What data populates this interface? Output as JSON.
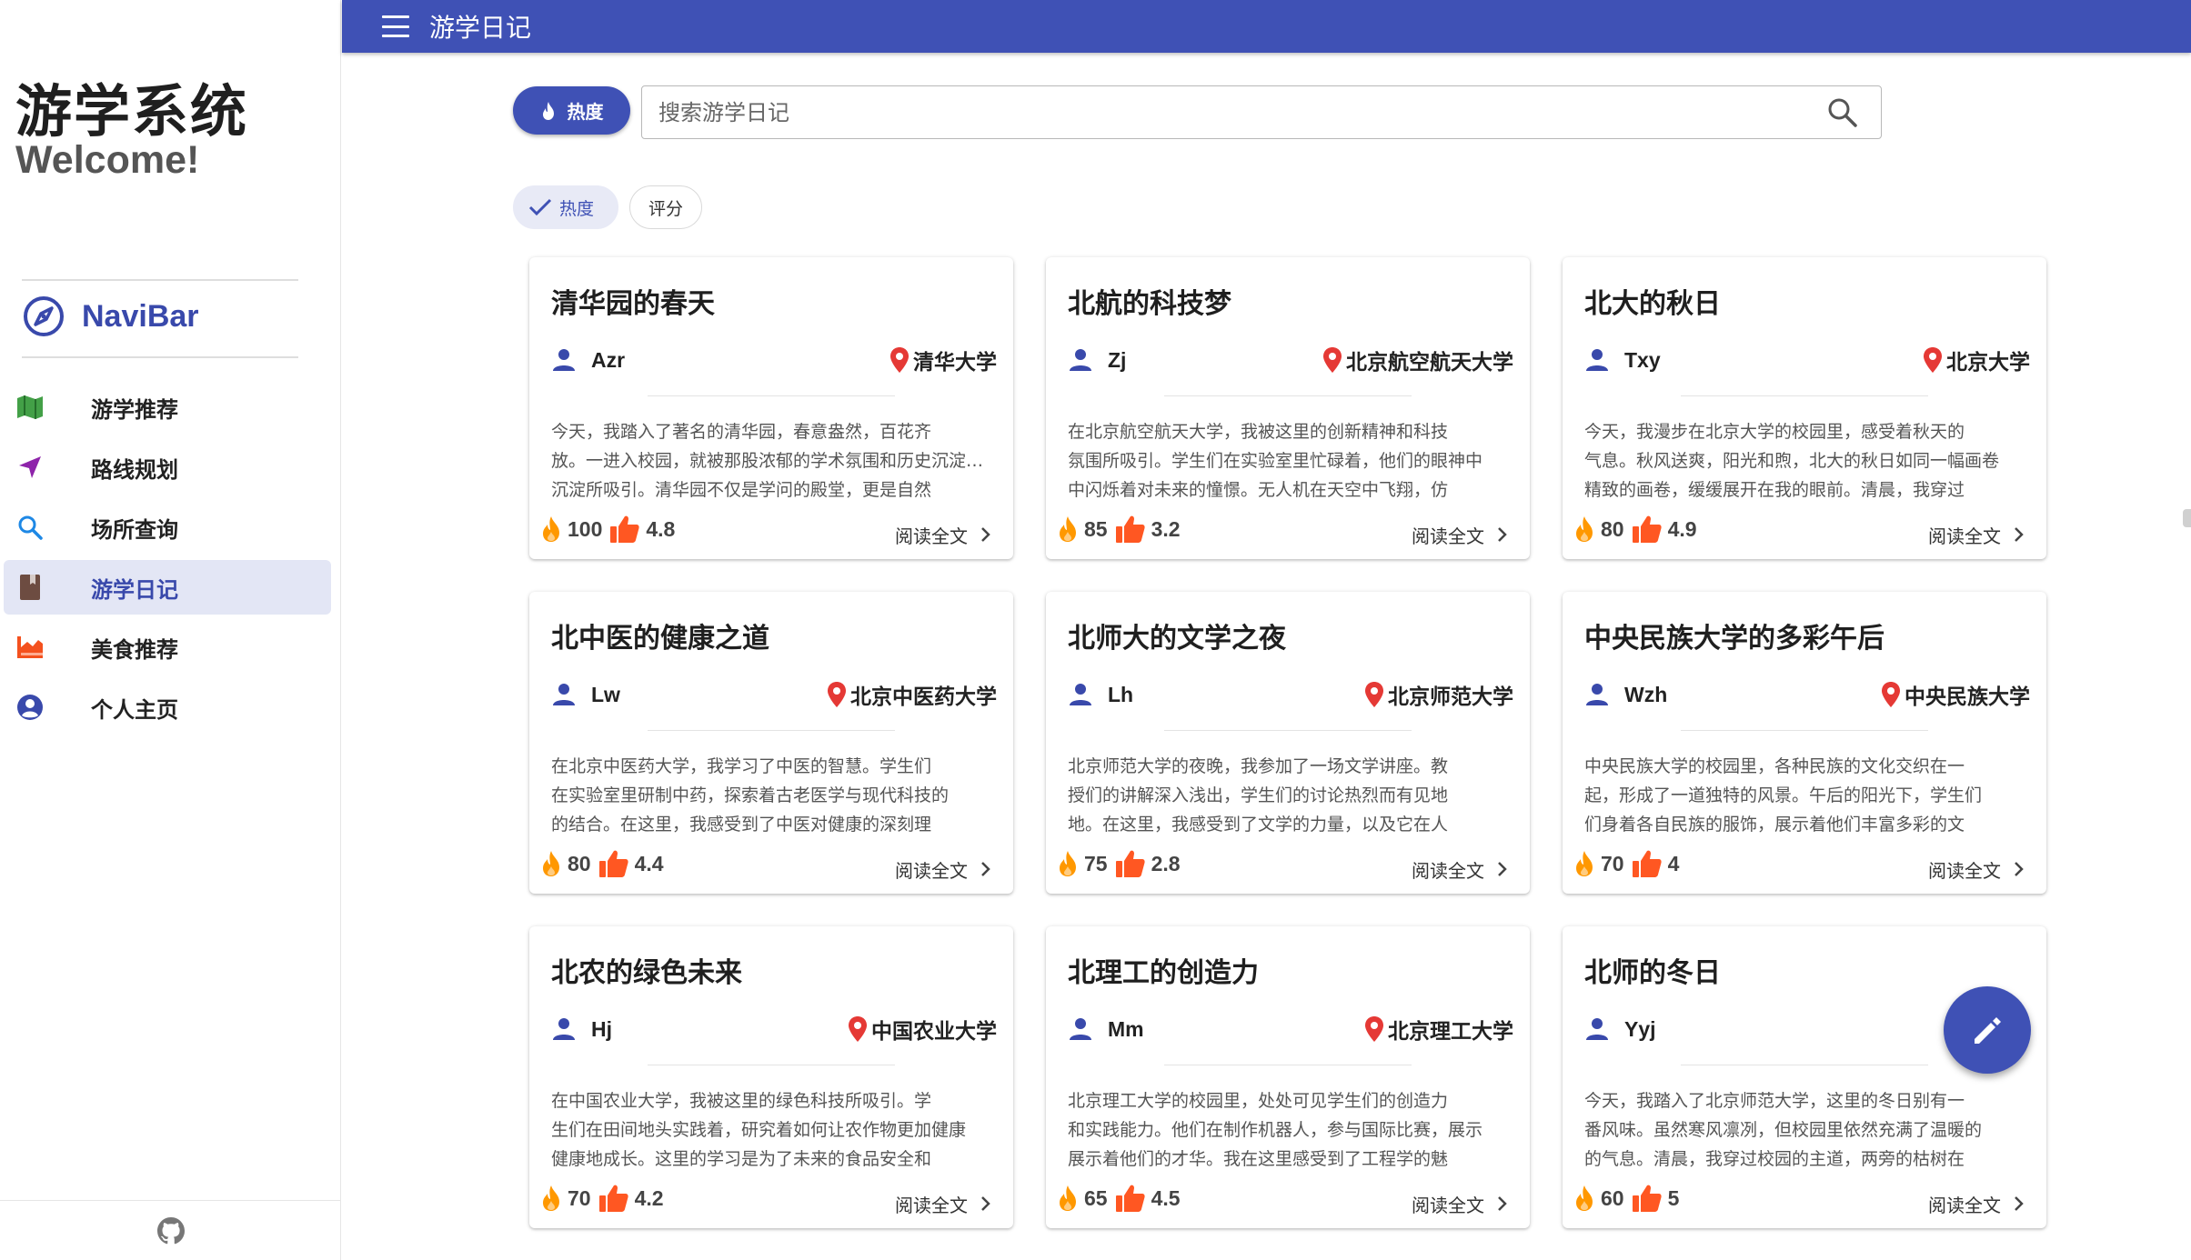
{
  "sidebar": {
    "title": "游学系统",
    "subtitle": "Welcome!",
    "navibar_label": "NaviBar",
    "items": [
      {
        "label": "游学推荐",
        "icon": "map-icon",
        "color": "#43a047"
      },
      {
        "label": "路线规划",
        "icon": "send-icon",
        "color": "#8e24aa"
      },
      {
        "label": "场所查询",
        "icon": "search-icon",
        "color": "#1e88e5"
      },
      {
        "label": "游学日记",
        "icon": "book-icon",
        "color": "#6d4c41",
        "active": true
      },
      {
        "label": "美食推荐",
        "icon": "food-icon",
        "color": "#f4511e"
      },
      {
        "label": "个人主页",
        "icon": "account-circle-icon",
        "color": "#3949ab"
      }
    ],
    "footer_icon": "github-icon"
  },
  "header": {
    "menu_icon": "menu-icon",
    "title": "游学日记",
    "bar_color": "#3f51b5"
  },
  "search": {
    "sort_button": "热度",
    "placeholder": "搜索游学日记",
    "icon": "search-icon"
  },
  "filters": {
    "hot": "热度",
    "hot_selected": true,
    "score": "评分"
  },
  "cards": [
    {
      "title": "清华园的春天",
      "author": "Azr",
      "place": "清华大学",
      "lines": [
        "今天，我踏入了著名的清华园，春意盎然，百花齐",
        "放。一进入校园，就被那股浓郁的学术氛围和历史沉淀所吸引。",
        "沉淀所吸引。清华园不仅是学问的殿堂，更是自然"
      ],
      "heat": "100",
      "rating": "4.8",
      "read_more": "阅读全文"
    },
    {
      "title": "北航的科技梦",
      "author": "Zj",
      "place": "北京航空航天大学",
      "lines": [
        "在北京航空航天大学，我被这里的创新精神和科技",
        "氛围所吸引。学生们在实验室里忙碌着，他们的眼神中",
        "中闪烁着对未来的憧憬。无人机在天空中飞翔，仿"
      ],
      "heat": "85",
      "rating": "3.2",
      "read_more": "阅读全文"
    },
    {
      "title": "北大的秋日",
      "author": "Txy",
      "place": "北京大学",
      "lines": [
        "今天，我漫步在北京大学的校园里，感受着秋天的",
        "气息。秋风送爽，阳光和煦，北大的秋日如同一幅画卷",
        "精致的画卷，缓缓展开在我的眼前。清晨，我穿过"
      ],
      "heat": "80",
      "rating": "4.9",
      "read_more": "阅读全文"
    },
    {
      "title": "北中医的健康之道",
      "author": "Lw",
      "place": "北京中医药大学",
      "lines": [
        "在北京中医药大学，我学习了中医的智慧。学生们",
        "在实验室里研制中药，探索着古老医学与现代科技的",
        "的结合。在这里，我感受到了中医对健康的深刻理"
      ],
      "heat": "80",
      "rating": "4.4",
      "read_more": "阅读全文"
    },
    {
      "title": "北师大的文学之夜",
      "author": "Lh",
      "place": "北京师范大学",
      "lines": [
        "北京师范大学的夜晚，我参加了一场文学讲座。教",
        "授们的讲解深入浅出，学生们的讨论热烈而有见地",
        "地。在这里，我感受到了文学的力量，以及它在人"
      ],
      "heat": "75",
      "rating": "2.8",
      "read_more": "阅读全文"
    },
    {
      "title": "中央民族大学的多彩午后",
      "author": "Wzh",
      "place": "中央民族大学",
      "lines": [
        "中央民族大学的校园里，各种民族的文化交织在一",
        "起，形成了一道独特的风景。午后的阳光下，学生们",
        "们身着各自民族的服饰，展示着他们丰富多彩的文"
      ],
      "heat": "70",
      "rating": "4",
      "read_more": "阅读全文"
    },
    {
      "title": "北农的绿色未来",
      "author": "Hj",
      "place": "中国农业大学",
      "lines": [
        "在中国农业大学，我被这里的绿色科技所吸引。学",
        "生们在田间地头实践着，研究着如何让农作物更加健康",
        "健康地成长。这里的学习是为了未来的食品安全和"
      ],
      "heat": "70",
      "rating": "4.2",
      "read_more": "阅读全文"
    },
    {
      "title": "北理工的创造力",
      "author": "Mm",
      "place": "北京理工大学",
      "lines": [
        "北京理工大学的校园里，处处可见学生们的创造力",
        "和实践能力。他们在制作机器人，参与国际比赛，展示",
        "展示着他们的才华。我在这里感受到了工程学的魅"
      ],
      "heat": "65",
      "rating": "4.5",
      "read_more": "阅读全文"
    },
    {
      "title": "北师的冬日",
      "author": "Yyj",
      "place": "北京",
      "lines": [
        "今天，我踏入了北京师范大学，这里的冬日别有一",
        "番风味。虽然寒风凛冽，但校园里依然充满了温暖的",
        "的气息。清晨，我穿过校园的主道，两旁的枯树在"
      ],
      "heat": "60",
      "rating": "5",
      "read_more": "阅读全文"
    }
  ],
  "fab_icon": "pencil-icon"
}
